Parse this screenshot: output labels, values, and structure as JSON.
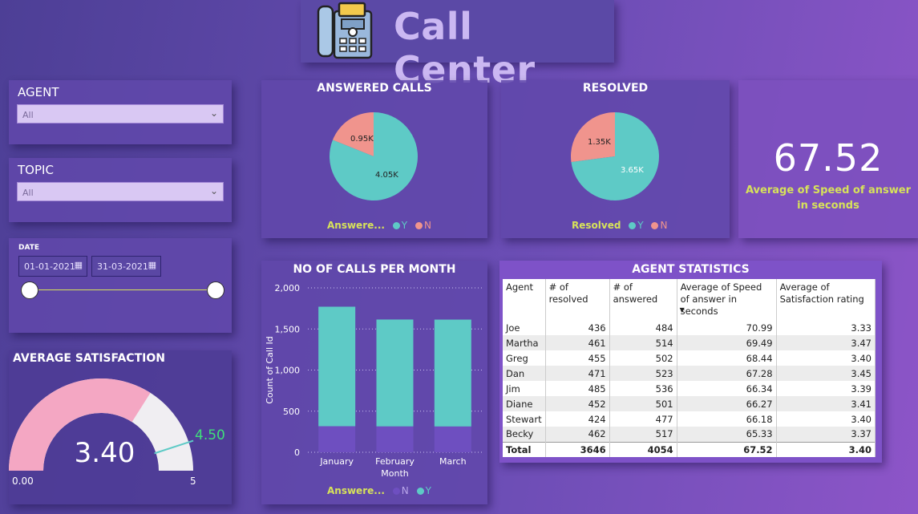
{
  "header": {
    "title": "Call Center"
  },
  "filters": {
    "agent": {
      "label": "AGENT",
      "value": "All"
    },
    "topic": {
      "label": "TOPIC",
      "value": "All"
    },
    "date": {
      "label": "DATE",
      "start": "01-01-2021",
      "end": "31-03-2021"
    }
  },
  "satisfaction": {
    "title": "AVERAGE SATISFACTION",
    "value": "3.40",
    "target": "4.50",
    "min": "0.00",
    "max": "5",
    "value_num": 3.4,
    "target_num": 4.5,
    "min_num": 0,
    "max_num": 5
  },
  "answered": {
    "title": "ANSWERED CALLS",
    "legend_title": "Answere...",
    "legend": [
      "Y",
      "N"
    ],
    "labels": {
      "y": "4.05K",
      "n": "0.95K"
    },
    "values": {
      "y": 4054,
      "n": 946
    }
  },
  "resolved": {
    "title": "RESOLVED",
    "legend_title": "Resolved",
    "legend": [
      "Y",
      "N"
    ],
    "labels": {
      "y": "3.65K",
      "n": "1.35K"
    },
    "values": {
      "y": 3646,
      "n": 1354
    }
  },
  "kpi": {
    "value": "67.52",
    "label_line1": "Average of Speed of answer",
    "label_line2": "in seconds"
  },
  "monthly": {
    "title": "NO OF CALLS PER MONTH",
    "legend_title": "Answere...",
    "legend": [
      "N",
      "Y"
    ]
  },
  "stats": {
    "title": "AGENT STATISTICS",
    "columns": [
      "Agent",
      "# of resolved",
      "# of answered",
      "Average of Speed of answer in seconds",
      "Average of Satisfaction rating"
    ],
    "rows": [
      [
        "Joe",
        "436",
        "484",
        "70.99",
        "3.33"
      ],
      [
        "Martha",
        "461",
        "514",
        "69.49",
        "3.47"
      ],
      [
        "Greg",
        "455",
        "502",
        "68.44",
        "3.40"
      ],
      [
        "Dan",
        "471",
        "523",
        "67.28",
        "3.45"
      ],
      [
        "Jim",
        "485",
        "536",
        "66.34",
        "3.39"
      ],
      [
        "Diane",
        "452",
        "501",
        "66.27",
        "3.41"
      ],
      [
        "Stewart",
        "424",
        "477",
        "66.18",
        "3.40"
      ],
      [
        "Becky",
        "462",
        "517",
        "65.33",
        "3.37"
      ]
    ],
    "total": [
      "Total",
      "3646",
      "4054",
      "67.52",
      "3.40"
    ]
  },
  "colors": {
    "teal": "#5ecac6",
    "salmon": "#f0948d",
    "purple": "#6e4fc0",
    "yellow": "#d7e25a",
    "pink": "#f4a7c3"
  },
  "chart_data": {
    "type": "bar",
    "title": "NO OF CALLS PER MONTH",
    "xlabel": "Month",
    "ylabel": "Count of Call Id",
    "categories": [
      "January",
      "February",
      "March"
    ],
    "series": [
      {
        "name": "N",
        "values": [
          317,
          315,
          314
        ]
      },
      {
        "name": "Y",
        "values": [
          1454,
          1300,
          1300
        ]
      }
    ],
    "stacked": true,
    "ylim": [
      0,
      2000
    ],
    "yticks": [
      "0",
      "500",
      "1,000",
      "1,500",
      "2,000"
    ],
    "grid": true,
    "legend": "bottom"
  }
}
